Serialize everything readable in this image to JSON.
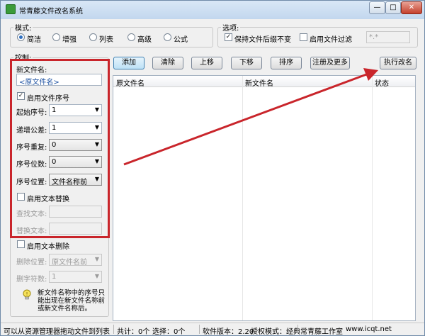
{
  "window": {
    "title": "常青藤文件改名系统",
    "title_suffix": "",
    "min_label": "—",
    "max_label": "□",
    "close_label": "✕"
  },
  "mode": {
    "label": "模式:",
    "options": [
      "简洁",
      "增强",
      "列表",
      "高级",
      "公式"
    ],
    "selected": "简洁"
  },
  "options": {
    "label": "选项:",
    "keep_ext_label": "保持文件后缀不变",
    "keep_ext_checked": true,
    "filter_label": "启用文件过滤",
    "filter_checked": false,
    "filter_value": "*.*"
  },
  "control": {
    "label": "控制:",
    "new_name_label": "新文件名:",
    "new_name_value": "<原文件名>",
    "enable_seq_label": "启用文件序号",
    "enable_seq_checked": true,
    "start_seq_label": "起始序号:",
    "start_seq_value": "1",
    "step_label": "递增公差:",
    "step_value": "1",
    "repeat_label": "序号重复:",
    "repeat_value": "0",
    "digits_label": "序号位数:",
    "digits_value": "0",
    "position_label": "序号位置:",
    "position_value": "文件名称前",
    "enable_replace_label": "启用文本替换",
    "enable_replace_checked": false,
    "find_label": "查找文本:",
    "replace_label": "替换文本:",
    "enable_delete_label": "启用文本删除",
    "enable_delete_checked": false,
    "delete_pos_label": "删除位置:",
    "delete_pos_value": "原文件名前",
    "delete_count_label": "删字符数:",
    "delete_count_value": "1",
    "hint": "新文件名称中的序号只能出现在新文件名称前或新文件名称后。"
  },
  "toolbar": {
    "add": "添加",
    "clear": "清除",
    "up": "上移",
    "down": "下移",
    "sort": "排序",
    "register": "注册及更多",
    "execute": "执行改名"
  },
  "list": {
    "columns": [
      "原文件名",
      "新文件名",
      "状态"
    ]
  },
  "status": {
    "hint": "可以从资源管理器拖动文件到列表",
    "total": "共计：0个",
    "selected": "选择：0个",
    "version": "软件版本：2.20",
    "license": "授权模式：经典",
    "studio": "常青藤工作室",
    "url": "www.icqt.net"
  },
  "annotation_colors": {
    "box": "#c9252b",
    "arrow": "#c9252b"
  }
}
